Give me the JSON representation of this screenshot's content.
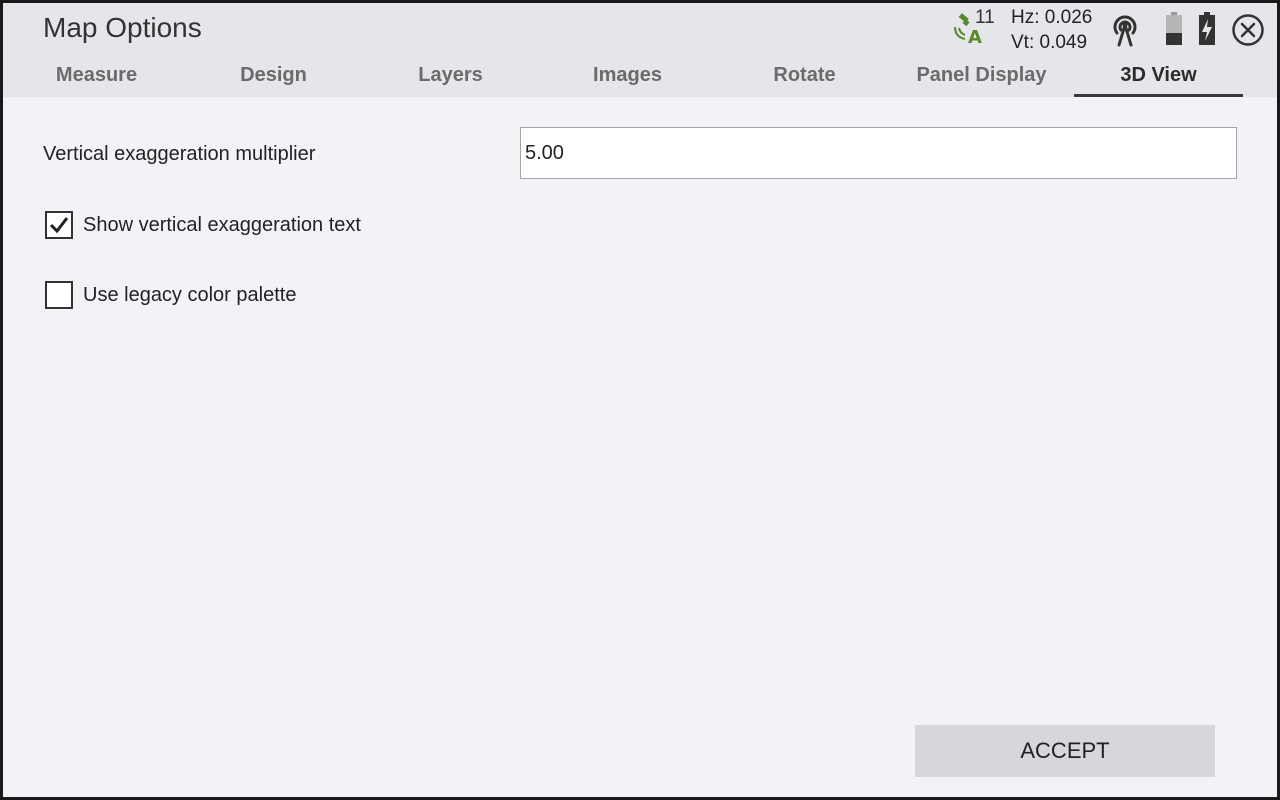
{
  "window": {
    "title": "Map Options"
  },
  "status": {
    "satellite_count": "11",
    "hz": "Hz: 0.026",
    "vt": "Vt: 0.049"
  },
  "tabs": [
    {
      "label": "Measure"
    },
    {
      "label": "Design"
    },
    {
      "label": "Layers"
    },
    {
      "label": "Images"
    },
    {
      "label": "Rotate"
    },
    {
      "label": "Panel Display"
    },
    {
      "label": "3D View",
      "active": true
    }
  ],
  "form": {
    "vertical_exaggeration_label": "Vertical exaggeration multiplier",
    "vertical_exaggeration_value": "5.00",
    "show_text_label": "Show vertical exaggeration text",
    "show_text_checked": true,
    "legacy_palette_label": "Use legacy color palette",
    "legacy_palette_checked": false
  },
  "actions": {
    "accept_label": "ACCEPT"
  },
  "colors": {
    "header_bg": "#e5e6ea",
    "body_bg": "#f2f3f7",
    "satellite_green": "#5a8a2e",
    "button_bg": "#d6d6db"
  },
  "icons": [
    "satellite-icon",
    "radio-signal-icon",
    "battery-icon",
    "battery-charging-icon",
    "close-icon",
    "checkmark-icon"
  ]
}
